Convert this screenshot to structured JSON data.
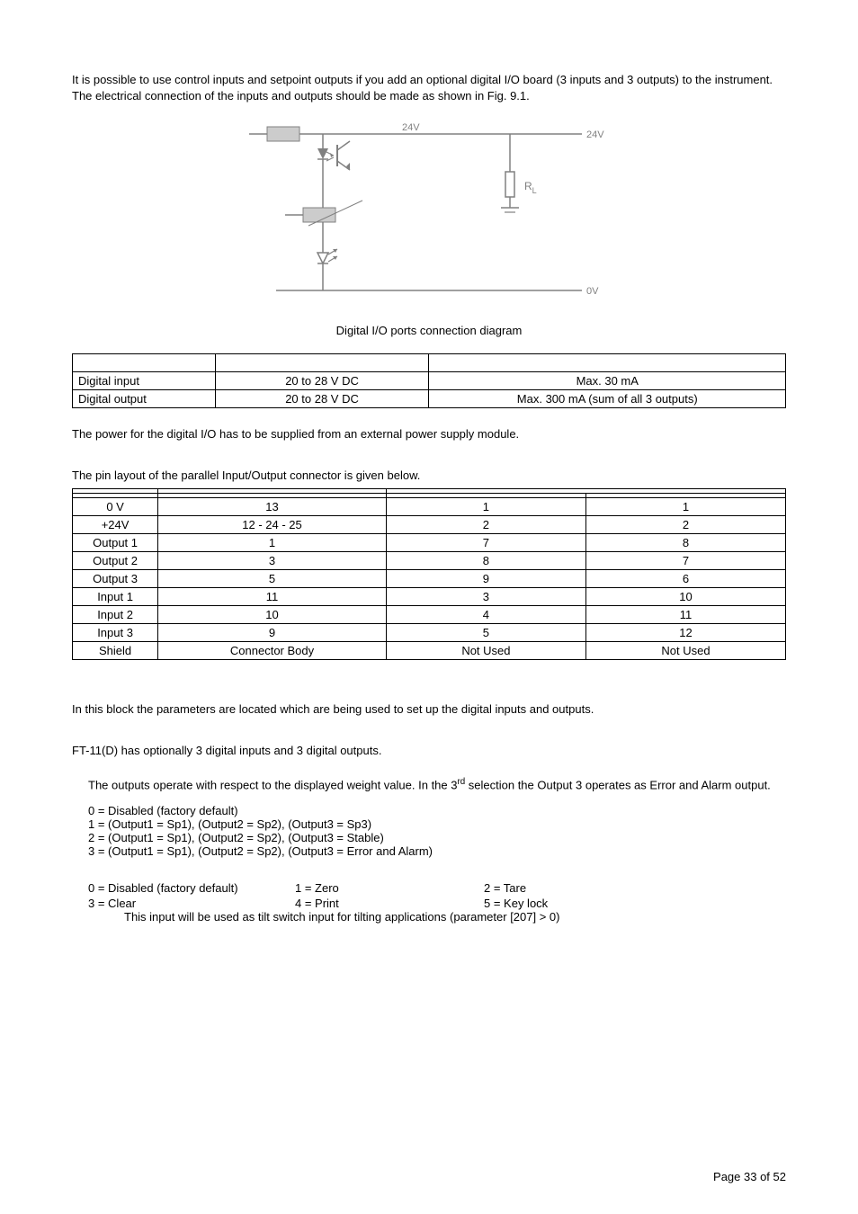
{
  "intro": "It is possible to use control inputs and setpoint outputs if you add an optional digital I/O board (3 inputs and 3 outputs) to the instrument. The electrical connection of the inputs and outputs should be made as shown in Fig. 9.1.",
  "diagram": {
    "label_24v_top": "24V",
    "label_24v_right": "24V",
    "label_rl": "R",
    "label_rl_sub": "L",
    "label_0v": "0V",
    "caption": "Digital I/O ports connection diagram"
  },
  "table1": {
    "rows": [
      [
        "Digital input",
        "20 to 28 V DC",
        "Max. 30 mA"
      ],
      [
        "Digital output",
        "20 to 28 V DC",
        "Max. 300 mA (sum of all 3 outputs)"
      ]
    ]
  },
  "power_note": "The power for the digital I/O has to be supplied from an external power supply module.",
  "pin_layout_intro": "The pin layout of the parallel Input/Output connector is given below.",
  "table2": {
    "header_empty_rows": 2,
    "rows": [
      [
        "0 V",
        "13",
        "1",
        "1"
      ],
      [
        "+24V",
        "12 - 24 - 25",
        "2",
        "2"
      ],
      [
        "Output 1",
        "1",
        "7",
        "8"
      ],
      [
        "Output 2",
        "3",
        "8",
        "7"
      ],
      [
        "Output 3",
        "5",
        "9",
        "6"
      ],
      [
        "Input 1",
        "11",
        "3",
        "10"
      ],
      [
        "Input 2",
        "10",
        "4",
        "11"
      ],
      [
        "Input 3",
        "9",
        "5",
        "12"
      ],
      [
        "Shield",
        "Connector Body",
        "Not Used",
        "Not Used"
      ]
    ]
  },
  "block_intro": "In this block the parameters are located which are being used to set up the digital inputs and outputs.",
  "ft_line": "FT-11(D) has optionally 3 digital inputs and 3 digital outputs.",
  "outputs_text_pre": "The outputs operate with respect to the displayed weight value. In the 3",
  "outputs_text_sup": "rd",
  "outputs_text_post": " selection the Output 3 operates as Error and Alarm output.",
  "output_options": [
    "0 =  Disabled (factory default)",
    "1 =  (Output1 = Sp1), (Output2 = Sp2), (Output3 = Sp3)",
    "2 =  (Output1 = Sp1), (Output2 = Sp2), (Output3 = Stable)",
    "3 =  (Output1 = Sp1), (Output2 = Sp2), (Output3 = Error and Alarm)"
  ],
  "inputs": {
    "r1c1": "0 = Disabled (factory default)",
    "r1c2": "1 = Zero",
    "r1c3": "2 = Tare",
    "r2c1": "3 = Clear",
    "r2c2": "4 = Print",
    "r2c3": "5 = Key lock",
    "tilt": "This input will be used as tilt switch input for tilting applications (parameter [207]  >  0)"
  },
  "page_number": "Page 33 of 52"
}
